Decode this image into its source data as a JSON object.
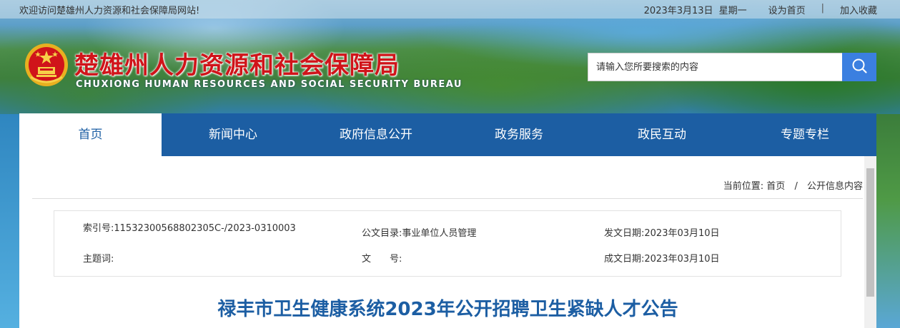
{
  "topbar": {
    "welcome": "欢迎访问楚雄州人力资源和社会保障局网站!",
    "date": "2023年3月13日",
    "weekday": "星期一",
    "set_home": "设为首页",
    "separator": "|",
    "add_favorite": "加入收藏"
  },
  "header": {
    "title": "楚雄州人力资源和社会保障局",
    "subtitle": "CHUXIONG HUMAN RESOURCES AND SOCIAL SECURITY BUREAU",
    "search_placeholder": "请输入您所要搜索的内容",
    "search_icon": "search-icon"
  },
  "nav": {
    "items": [
      {
        "label": "首页",
        "active": true
      },
      {
        "label": "新闻中心"
      },
      {
        "label": "政府信息公开"
      },
      {
        "label": "政务服务"
      },
      {
        "label": "政民互动"
      },
      {
        "label": "专题专栏"
      }
    ]
  },
  "breadcrumb": {
    "prefix": "当前位置:",
    "home": "首页",
    "separator": "/",
    "current": "公开信息内容"
  },
  "meta": {
    "index_label": "索引号:",
    "index_value": "11532300568802305C-/2023-0310003",
    "catalog_label": "公文目录:",
    "catalog_value": "事业单位人员管理",
    "issue_date_label": "发文日期:",
    "issue_date_value": "2023年03月10日",
    "keywords_label": "主题词:",
    "keywords_value": "",
    "doc_no_label": "文　　号:",
    "doc_no_value": "",
    "written_date_label": "成文日期:",
    "written_date_value": "2023年03月10日"
  },
  "article": {
    "title": "禄丰市卫生健康系统2023年公开招聘卫生紧缺人才公告"
  },
  "colors": {
    "nav_bg": "#1c5ea3",
    "title_red": "#d0141a",
    "search_btn": "#3b7fe0"
  }
}
